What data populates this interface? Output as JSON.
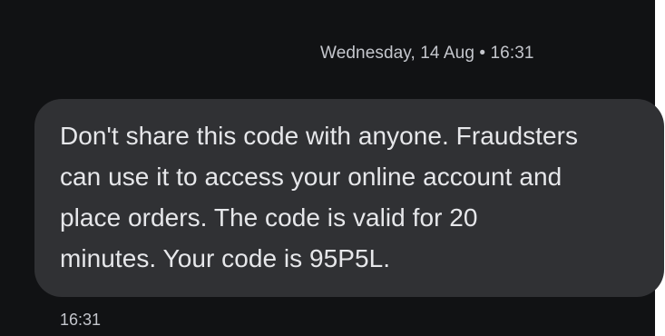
{
  "conversation": {
    "date_header": "Wednesday, 14 Aug • 16:31",
    "messages": [
      {
        "lines": [
          "Don't share this code with anyone. Fraudsters",
          "can use it to access your online account and",
          "place orders. The code is valid for 20",
          "minutes. Your code is 95P5L."
        ],
        "time": "16:31"
      }
    ]
  },
  "colors": {
    "background": "#111214",
    "bubble": "#303134",
    "text": "#e6e7ea",
    "secondary_text": "#c4c6cc"
  }
}
